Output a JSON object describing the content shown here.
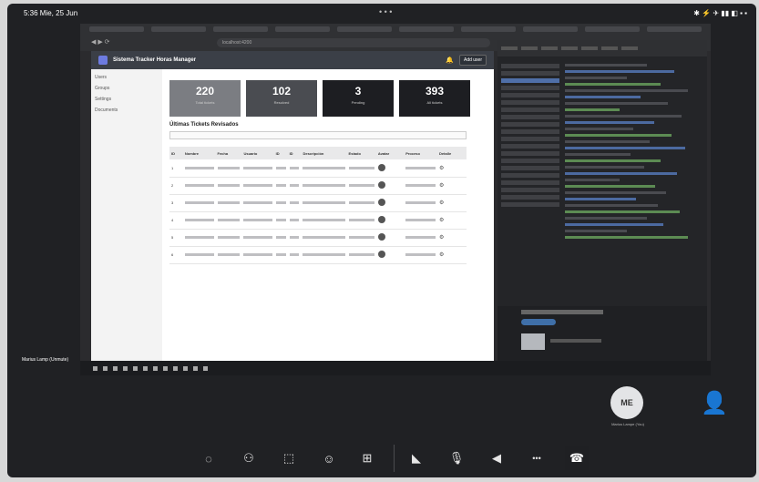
{
  "statusbar": {
    "time": "5:36  Mie, 25 Jun",
    "system": "✱ ⚡ ✈ ▮▮ ◧ ▪ ▪"
  },
  "browser": {
    "url": "localhost:4200"
  },
  "webapp": {
    "title": "Sistema Tracker Horas Manager",
    "add_button": "Add user",
    "sidebar": [
      "Users",
      "Groups",
      "Settings",
      "Documents"
    ],
    "cards": [
      {
        "value": "220",
        "label": "Total tickets"
      },
      {
        "value": "102",
        "label": "Resolved"
      },
      {
        "value": "3",
        "label": "Pending"
      },
      {
        "value": "393",
        "label": "All tickets"
      }
    ],
    "table_title": "Últimas Tickets Revisados",
    "columns": [
      "ID",
      "Nombre",
      "Fecha",
      "Usuario",
      "ID",
      "ID",
      "Descripción",
      "Estado",
      "Avatar",
      "Proceso",
      "Detalle"
    ],
    "rows": [
      {
        "id": "1"
      },
      {
        "id": "2"
      },
      {
        "id": "3"
      },
      {
        "id": "4"
      },
      {
        "id": "5"
      },
      {
        "id": "6"
      }
    ]
  },
  "meeting": {
    "screen_label": "Marius Lamp (Unmute)",
    "me_initials": "ME",
    "me_caption": "Marius Lampe (You)",
    "participant_icon": "person-silhouette-icon"
  },
  "controls": [
    {
      "name": "chat-icon",
      "glyph": "◌"
    },
    {
      "name": "people-icon",
      "glyph": "⚇"
    },
    {
      "name": "share-icon",
      "glyph": "⬚"
    },
    {
      "name": "react-icon",
      "glyph": "☺"
    },
    {
      "name": "more-apps-icon",
      "glyph": "⊞"
    },
    {
      "name": "camera-off-icon",
      "glyph": "◣"
    },
    {
      "name": "mic-icon",
      "glyph": "🎙"
    },
    {
      "name": "speaker-icon",
      "glyph": "◀"
    },
    {
      "name": "more-icon",
      "glyph": "•••"
    },
    {
      "name": "hangup-icon",
      "glyph": "☎"
    }
  ]
}
